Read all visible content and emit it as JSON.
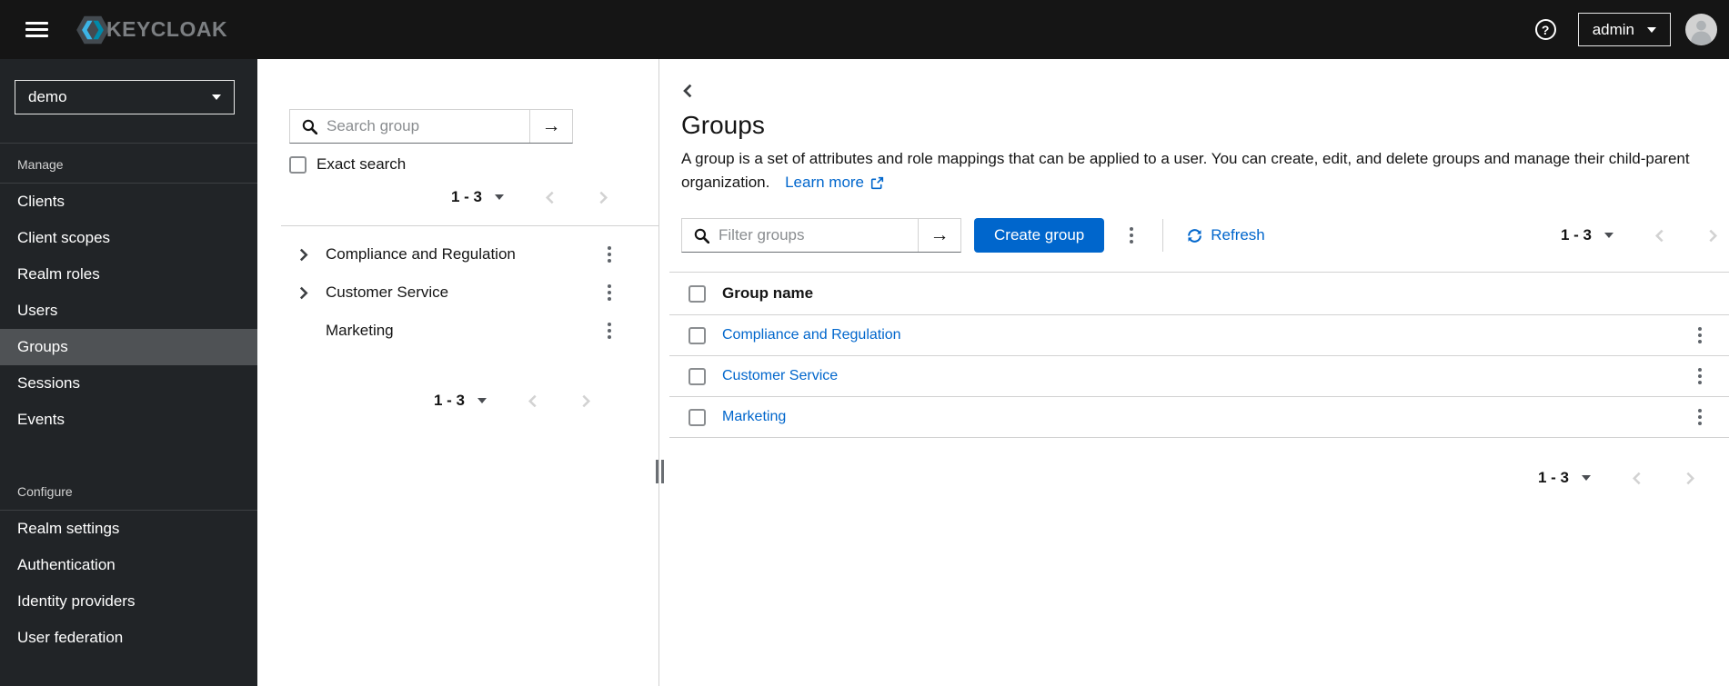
{
  "masthead": {
    "brand": "KEYCLOAK",
    "user_menu_label": "admin"
  },
  "sidebar": {
    "realm": "demo",
    "sections": [
      {
        "label": "Manage",
        "items": [
          {
            "label": "Clients",
            "selected": false
          },
          {
            "label": "Client scopes",
            "selected": false
          },
          {
            "label": "Realm roles",
            "selected": false
          },
          {
            "label": "Users",
            "selected": false
          },
          {
            "label": "Groups",
            "selected": true
          },
          {
            "label": "Sessions",
            "selected": false
          },
          {
            "label": "Events",
            "selected": false
          }
        ]
      },
      {
        "label": "Configure",
        "items": [
          {
            "label": "Realm settings",
            "selected": false
          },
          {
            "label": "Authentication",
            "selected": false
          },
          {
            "label": "Identity providers",
            "selected": false
          },
          {
            "label": "User federation",
            "selected": false
          }
        ]
      }
    ]
  },
  "tree_panel": {
    "search_placeholder": "Search group",
    "exact_search_label": "Exact search",
    "pagination_range": "1 - 3",
    "items": [
      {
        "label": "Compliance and Regulation",
        "expandable": true
      },
      {
        "label": "Customer Service",
        "expandable": true
      },
      {
        "label": "Marketing",
        "expandable": false
      }
    ]
  },
  "main": {
    "title": "Groups",
    "description": "A group is a set of attributes and role mappings that can be applied to a user. You can create, edit, and delete groups and manage their child-parent organization.",
    "learn_more_label": "Learn more",
    "toolbar": {
      "filter_placeholder": "Filter groups",
      "create_button_label": "Create group",
      "refresh_label": "Refresh"
    },
    "pagination_range": "1 - 3",
    "table": {
      "header": "Group name",
      "rows": [
        {
          "name": "Compliance and Regulation"
        },
        {
          "name": "Customer Service"
        },
        {
          "name": "Marketing"
        }
      ]
    }
  },
  "icons": {
    "hamburger": "bars",
    "help": "?",
    "caret_down": "▾",
    "search": "magnifier",
    "arrow_right": "→",
    "kebab": "⋮",
    "angle_right": "›",
    "angle_left": "‹",
    "external_link": "↗",
    "refresh": "⟳",
    "avatar": "user-circle"
  },
  "colors": {
    "primary_blue": "#0066cc",
    "link_blue": "#0066cc",
    "masthead_bg": "#151515",
    "sidebar_bg": "#212427",
    "sidebar_selected_bg": "#4f5255",
    "logo_cyan": "#3cb4e6",
    "border_gray": "#d2d2d2"
  }
}
